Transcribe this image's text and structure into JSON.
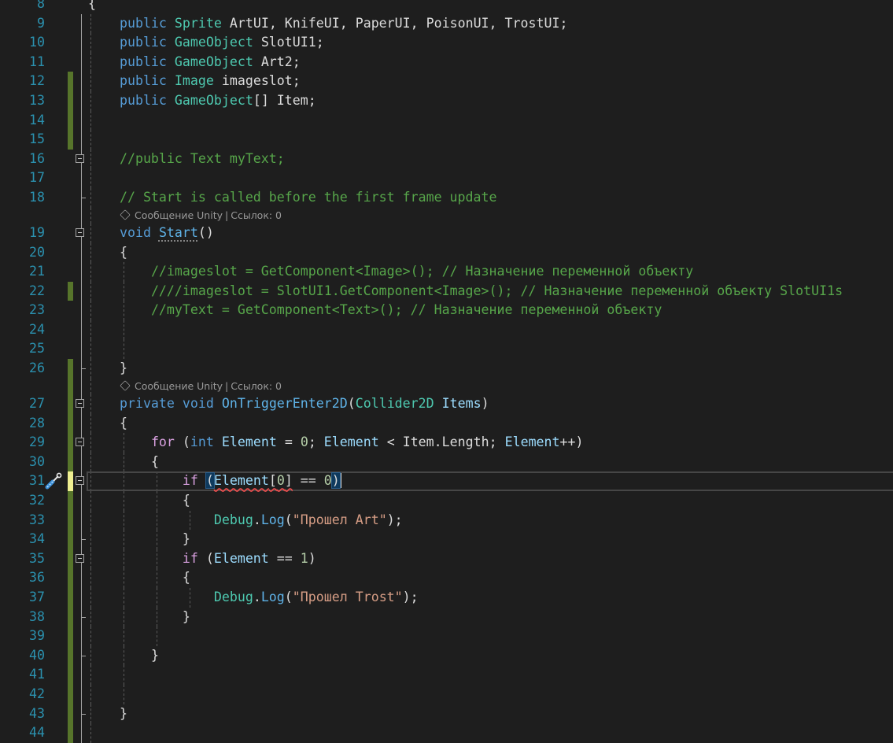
{
  "editor": {
    "codelens": {
      "unity_message": "Сообщение Unity",
      "separator": "|",
      "references": "Ссылок: 0"
    },
    "lines": [
      {
        "n": "8",
        "t": [
          [
            "{",
            "pl"
          ]
        ]
      },
      {
        "n": "9",
        "t": [
          [
            "    ",
            ""
          ],
          [
            "public",
            "kw"
          ],
          [
            " ",
            ""
          ],
          [
            "Sprite",
            "ty"
          ],
          [
            " ArtUI, KnifeUI, PaperUI, PoisonUI, TrostUI;",
            "pl"
          ]
        ]
      },
      {
        "n": "10",
        "t": [
          [
            "    ",
            ""
          ],
          [
            "public",
            "kw"
          ],
          [
            " ",
            ""
          ],
          [
            "GameObject",
            "ty"
          ],
          [
            " SlotUI1;",
            "pl"
          ]
        ]
      },
      {
        "n": "11",
        "t": [
          [
            "    ",
            ""
          ],
          [
            "public",
            "kw"
          ],
          [
            " ",
            ""
          ],
          [
            "GameObject",
            "ty"
          ],
          [
            " Art2;",
            "pl"
          ]
        ]
      },
      {
        "n": "12",
        "chg": "g",
        "t": [
          [
            "    ",
            ""
          ],
          [
            "public",
            "kw"
          ],
          [
            " ",
            ""
          ],
          [
            "Image",
            "ty"
          ],
          [
            " imageslot;",
            "pl"
          ]
        ]
      },
      {
        "n": "13",
        "chg": "g",
        "t": [
          [
            "    ",
            ""
          ],
          [
            "public",
            "kw"
          ],
          [
            " ",
            ""
          ],
          [
            "GameObject",
            "ty"
          ],
          [
            "[] Item;",
            "pl"
          ]
        ]
      },
      {
        "n": "14",
        "chg": "g",
        "t": [
          [
            "    ",
            ""
          ]
        ]
      },
      {
        "n": "15",
        "chg": "g",
        "t": [
          [
            "    ",
            ""
          ]
        ]
      },
      {
        "n": "16",
        "fold": true,
        "t": [
          [
            "    ",
            ""
          ],
          [
            "//public Text myText;",
            "cm"
          ]
        ]
      },
      {
        "n": "17",
        "t": [
          [
            "    ",
            ""
          ]
        ]
      },
      {
        "n": "18",
        "foldend": true,
        "t": [
          [
            "    ",
            ""
          ],
          [
            "// Start is called before the first frame update",
            "cm"
          ]
        ]
      },
      {
        "lens": true
      },
      {
        "n": "19",
        "fold": true,
        "t": [
          [
            "    ",
            ""
          ],
          [
            "void",
            "kw"
          ],
          [
            " ",
            ""
          ],
          [
            "Start",
            "me",
            "dots"
          ],
          [
            "()",
            "pl"
          ]
        ]
      },
      {
        "n": "20",
        "t": [
          [
            "    ",
            ""
          ],
          [
            "{",
            "pl"
          ]
        ]
      },
      {
        "n": "21",
        "t": [
          [
            "        ",
            ""
          ],
          [
            "//imageslot = GetComponent<Image>(); // Назначение переменной объекту",
            "cm"
          ]
        ]
      },
      {
        "n": "22",
        "chg": "g",
        "t": [
          [
            "        ",
            ""
          ],
          [
            "////imageslot = SlotUI1.GetComponent<Image>(); // Назначение переменной объекту SlotUI1s",
            "cm"
          ]
        ]
      },
      {
        "n": "23",
        "t": [
          [
            "        ",
            ""
          ],
          [
            "//myText = GetComponent<Text>(); // Назначение переменной объекту",
            "cm"
          ]
        ]
      },
      {
        "n": "24",
        "t": [
          [
            "        ",
            ""
          ]
        ]
      },
      {
        "n": "25",
        "t": [
          [
            "        ",
            ""
          ]
        ]
      },
      {
        "n": "26",
        "chg": "g",
        "foldend": true,
        "t": [
          [
            "    ",
            ""
          ],
          [
            "}",
            "pl"
          ]
        ]
      },
      {
        "lens": true,
        "chg": "g"
      },
      {
        "n": "27",
        "chg": "g",
        "fold": true,
        "t": [
          [
            "    ",
            ""
          ],
          [
            "private",
            "kw"
          ],
          [
            " ",
            ""
          ],
          [
            "void",
            "kw"
          ],
          [
            " ",
            ""
          ],
          [
            "OnTriggerEnter2D",
            "me"
          ],
          [
            "(",
            "pl"
          ],
          [
            "Collider2D",
            "ty"
          ],
          [
            " ",
            ""
          ],
          [
            "Items",
            "va"
          ],
          [
            ")",
            "pl"
          ]
        ]
      },
      {
        "n": "28",
        "chg": "g",
        "t": [
          [
            "    ",
            ""
          ],
          [
            "{",
            "pl"
          ]
        ]
      },
      {
        "n": "29",
        "chg": "g",
        "fold": true,
        "t": [
          [
            "        ",
            ""
          ],
          [
            "for",
            "ct"
          ],
          [
            " (",
            "pl"
          ],
          [
            "int",
            "kw"
          ],
          [
            " ",
            ""
          ],
          [
            "Element",
            "va"
          ],
          [
            " = ",
            "pl"
          ],
          [
            "0",
            "nu"
          ],
          [
            "; ",
            "pl"
          ],
          [
            "Element",
            "va"
          ],
          [
            " < Item.Length; ",
            "pl"
          ],
          [
            "Element",
            "va"
          ],
          [
            "++)",
            "pl"
          ]
        ]
      },
      {
        "n": "30",
        "chg": "g",
        "t": [
          [
            "        ",
            ""
          ],
          [
            "{",
            "pl"
          ]
        ]
      },
      {
        "n": "31",
        "chg": "y",
        "fold": true,
        "current": true,
        "bulb": true,
        "t": [
          [
            "            ",
            ""
          ],
          [
            "if",
            "ct"
          ],
          [
            " ",
            ""
          ],
          [
            "(",
            "pl",
            "brace"
          ],
          [
            "Element",
            "va",
            "squig"
          ],
          [
            "[",
            "pl",
            "squig"
          ],
          [
            "0",
            "nu",
            "squig"
          ],
          [
            "]",
            "pl",
            "squig"
          ],
          [
            " == ",
            "pl"
          ],
          [
            "0",
            "nu"
          ],
          [
            ")",
            "pl",
            "brace"
          ],
          [
            "",
            "",
            "caret"
          ]
        ]
      },
      {
        "n": "32",
        "chg": "g",
        "t": [
          [
            "            ",
            ""
          ],
          [
            "{",
            "pl"
          ]
        ]
      },
      {
        "n": "33",
        "chg": "g",
        "t": [
          [
            "                ",
            ""
          ],
          [
            "Debug",
            "ty"
          ],
          [
            ".",
            "pl"
          ],
          [
            "Log",
            "me"
          ],
          [
            "(",
            "pl"
          ],
          [
            "\"Прошел Art\"",
            "st"
          ],
          [
            ");",
            "pl"
          ]
        ]
      },
      {
        "n": "34",
        "chg": "g",
        "foldend": true,
        "t": [
          [
            "            ",
            ""
          ],
          [
            "}",
            "pl"
          ]
        ]
      },
      {
        "n": "35",
        "chg": "g",
        "fold": true,
        "t": [
          [
            "            ",
            ""
          ],
          [
            "if",
            "ct"
          ],
          [
            " (",
            "pl"
          ],
          [
            "Element",
            "va"
          ],
          [
            " == ",
            "pl"
          ],
          [
            "1",
            "nu"
          ],
          [
            ")",
            "pl"
          ]
        ]
      },
      {
        "n": "36",
        "chg": "g",
        "t": [
          [
            "            ",
            ""
          ],
          [
            "{",
            "pl"
          ]
        ]
      },
      {
        "n": "37",
        "chg": "g",
        "t": [
          [
            "                ",
            ""
          ],
          [
            "Debug",
            "ty"
          ],
          [
            ".",
            "pl"
          ],
          [
            "Log",
            "me"
          ],
          [
            "(",
            "pl"
          ],
          [
            "\"Прошел Trost\"",
            "st"
          ],
          [
            ");",
            "pl"
          ]
        ]
      },
      {
        "n": "38",
        "chg": "g",
        "foldend": true,
        "t": [
          [
            "            ",
            ""
          ],
          [
            "}",
            "pl"
          ]
        ]
      },
      {
        "n": "39",
        "chg": "g",
        "t": [
          [
            "            ",
            ""
          ]
        ]
      },
      {
        "n": "40",
        "chg": "g",
        "foldend": true,
        "t": [
          [
            "        ",
            ""
          ],
          [
            "}",
            "pl"
          ]
        ]
      },
      {
        "n": "41",
        "chg": "g",
        "t": [
          [
            "        ",
            ""
          ]
        ]
      },
      {
        "n": "42",
        "chg": "g",
        "t": [
          [
            "        ",
            ""
          ]
        ]
      },
      {
        "n": "43",
        "chg": "g",
        "foldend": true,
        "t": [
          [
            "    ",
            ""
          ],
          [
            "}",
            "pl"
          ]
        ]
      },
      {
        "n": "44",
        "chg": "g",
        "t": [
          [
            "    ",
            ""
          ]
        ]
      }
    ]
  }
}
